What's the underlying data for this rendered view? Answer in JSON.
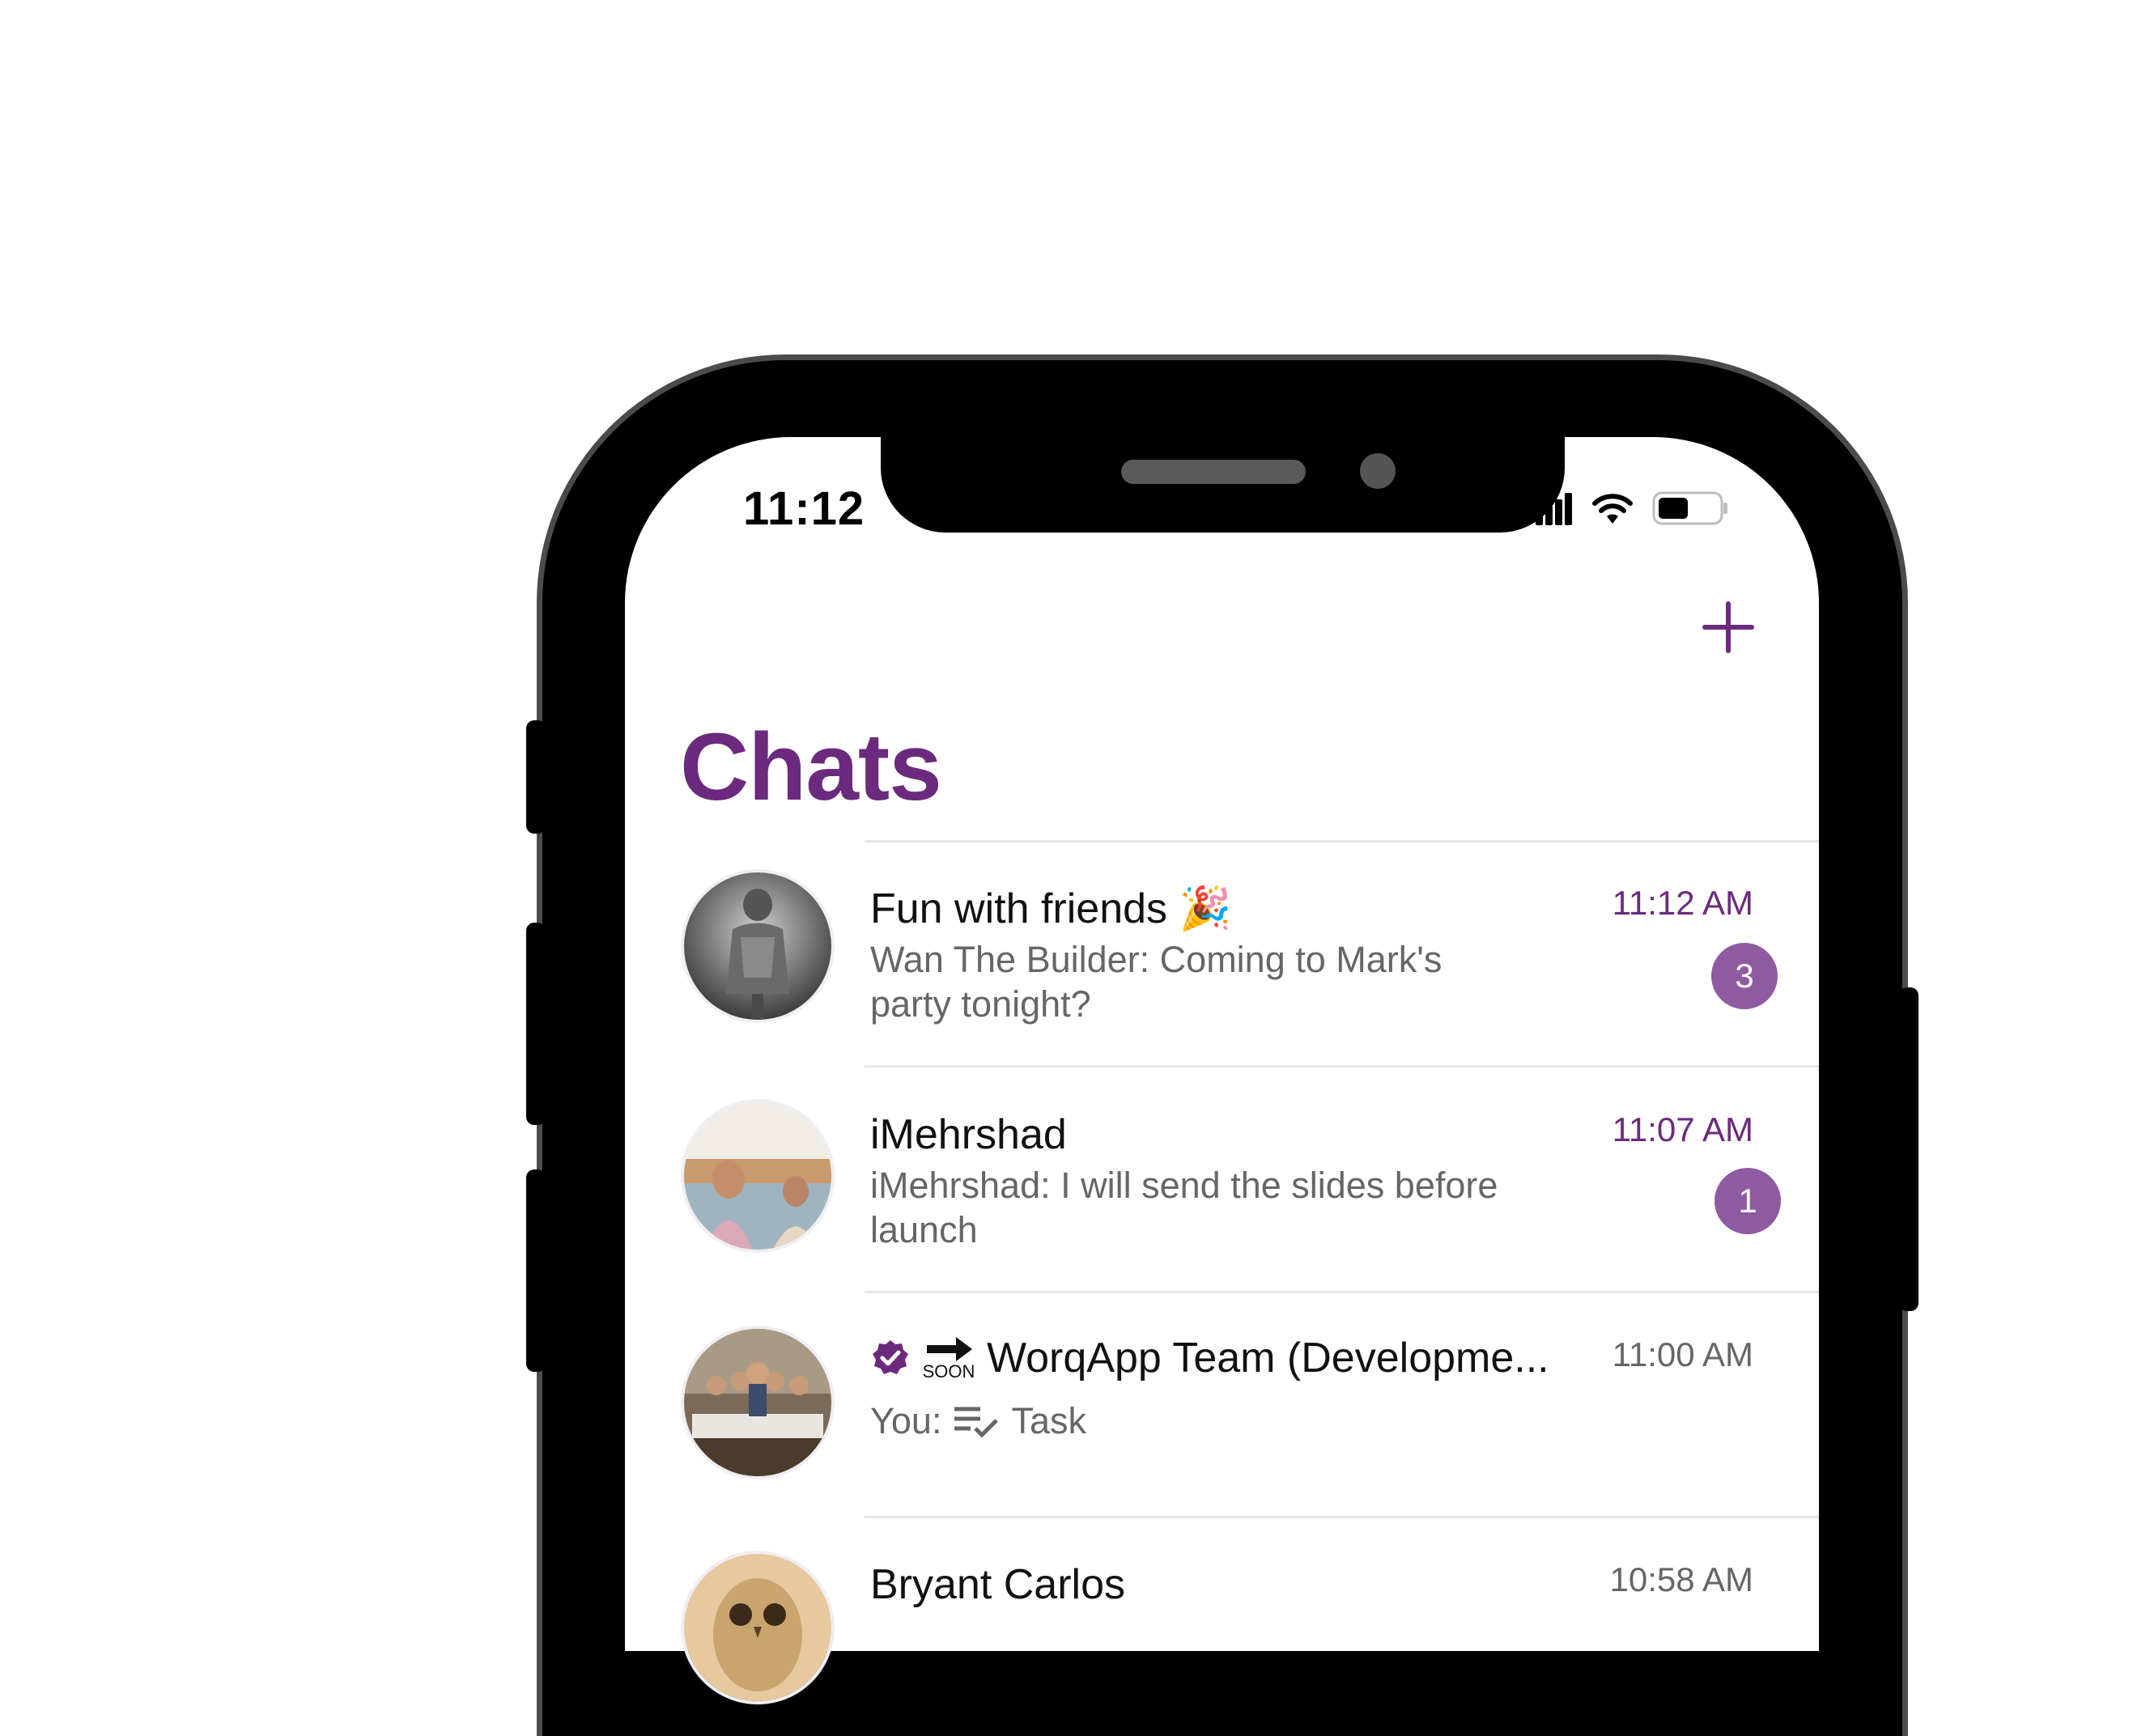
{
  "status_bar": {
    "time": "11:12"
  },
  "header": {
    "title": "Chats",
    "add_icon": "plus-icon"
  },
  "colors": {
    "accent": "#6b2a7e",
    "badge": "#8e5aa1",
    "muted_text": "#666666"
  },
  "chats": [
    {
      "name": "Fun with friends",
      "name_emoji": "🎉",
      "preview": "Wan The Builder: Coming to Mark's party tonight?",
      "time": "11:12 AM",
      "unread": "3",
      "avatar_icon": "knight-photo-avatar"
    },
    {
      "name": "iMehrshad",
      "preview": "iMehrshad: I will send the slides before launch",
      "time": "11:07 AM",
      "unread": "1",
      "avatar_icon": "children-photo-avatar"
    },
    {
      "name": "WorqApp Team (Developme...",
      "prefix_icons": [
        "verified-check-icon",
        "soon-arrow-icon"
      ],
      "soon_label": "SOON",
      "preview_prefix": "You:",
      "preview_icon": "task-list-icon",
      "preview": "Task",
      "time": "11:00 AM",
      "avatar_icon": "group-photo-avatar"
    },
    {
      "name": "Bryant Carlos",
      "time": "10:58 AM",
      "avatar_icon": "owl-photo-avatar"
    }
  ]
}
